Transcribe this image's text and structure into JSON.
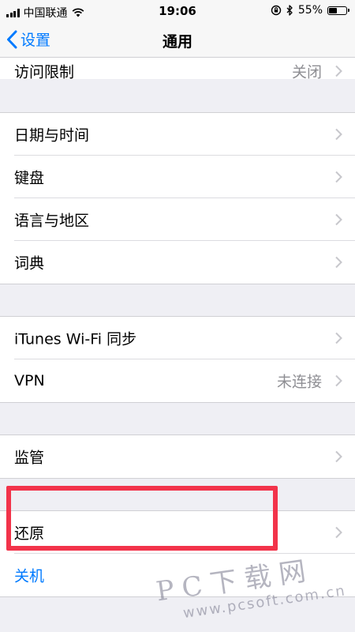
{
  "status_bar": {
    "carrier": "中国联通",
    "time": "19:06",
    "battery_percent": "55%",
    "battery_level": 0.55
  },
  "nav": {
    "back_label": "设置",
    "title": "通用"
  },
  "rows": {
    "restrictions": {
      "label": "访问限制",
      "value": "关闭"
    },
    "date_time": {
      "label": "日期与时间"
    },
    "keyboard": {
      "label": "键盘"
    },
    "language_region": {
      "label": "语言与地区"
    },
    "dictionary": {
      "label": "词典"
    },
    "itunes_wifi_sync": {
      "label": "iTunes Wi-Fi 同步"
    },
    "vpn": {
      "label": "VPN",
      "value": "未连接"
    },
    "supervision": {
      "label": "监管"
    },
    "reset": {
      "label": "还原"
    },
    "shutdown": {
      "label": "关机"
    }
  },
  "watermark": {
    "line1": "PC下载网",
    "line2": "www.pcsoft.com.cn"
  },
  "colors": {
    "accent": "#007aff",
    "highlight": "#f2334a",
    "background": "#efeff4"
  }
}
